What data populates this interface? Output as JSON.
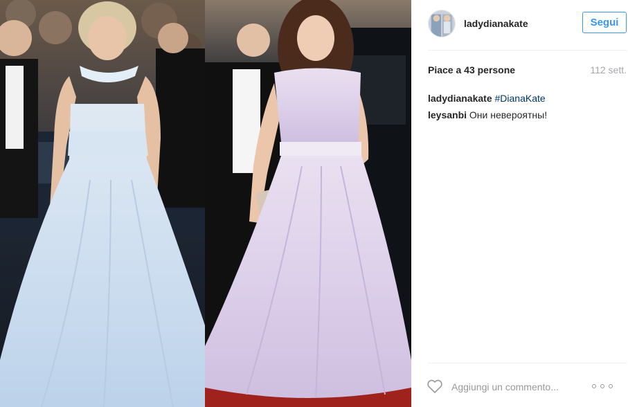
{
  "post": {
    "image": {
      "left_alt": "Diana in pale blue strapless gown",
      "right_alt": "Kate in lilac cap-sleeve gown"
    },
    "header": {
      "username": "ladydianakate",
      "follow_label": "Segui",
      "avatar_icon": "profile-avatar-icon"
    },
    "stats": {
      "likes_text": "Piace a 43 persone",
      "timestamp": "112 sett."
    },
    "comments": [
      {
        "user": "ladydianakate",
        "text": "",
        "hashtag": "#DianaKate"
      },
      {
        "user": "leysanbi",
        "text": "Они невероятны!",
        "hashtag": ""
      }
    ],
    "footer": {
      "like_icon": "heart-icon",
      "comment_placeholder": "Aggiungi un commento...",
      "more_icon": "more-options-icon"
    },
    "colors": {
      "accent": "#3897f0",
      "hashtag": "#003569",
      "muted": "#a5a7aa",
      "text": "#262626"
    }
  }
}
